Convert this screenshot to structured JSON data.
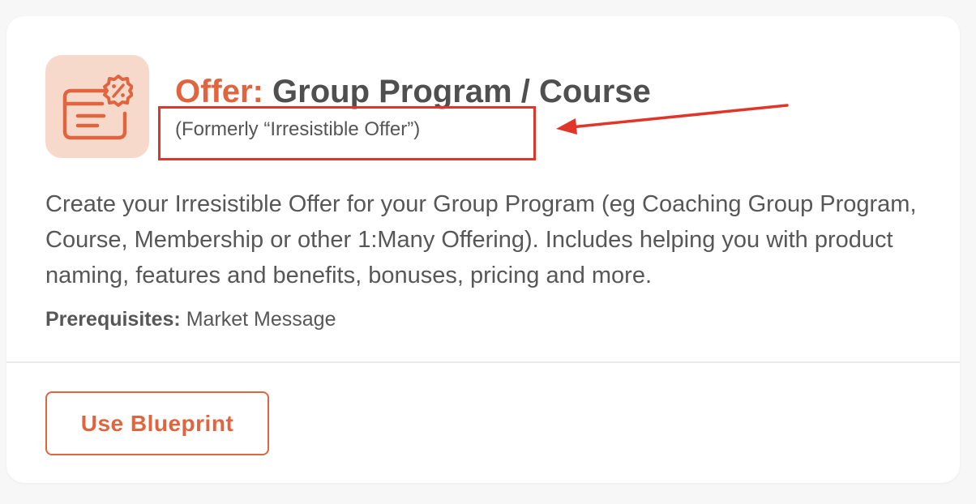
{
  "card": {
    "icon": "offer-blueprint-icon",
    "title_prefix": "Offer:",
    "title": "Group Program / Course",
    "subtitle": "(Formerly “Irresistible Offer”)",
    "description": "Create your Irresistible Offer for your Group Program (eg Coaching Group Program, Course, Membership or other 1:Many Offering). Includes helping you with product naming, features and benefits, bonuses, pricing and more.",
    "prerequisites_label": "Prerequisites:",
    "prerequisites_value": "Market Message",
    "button_label": "Use Blueprint"
  },
  "annotation": {
    "highlight": "red-rectangle",
    "arrow": "red-arrow"
  },
  "colors": {
    "accent": "#e0653f",
    "icon_tile_bg": "#f7d9cc",
    "annotation": "#e2352a",
    "text": "#575757",
    "page_bg": "#f7f7f7"
  }
}
